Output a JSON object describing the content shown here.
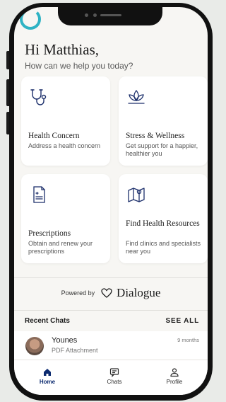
{
  "header": {
    "greeting": "Hi Matthias,",
    "subtitle": "How can we help you today?"
  },
  "cards": [
    {
      "title": "Health Concern",
      "description": "Address a health concern",
      "icon": "stethoscope-icon"
    },
    {
      "title": "Stress & Wellness",
      "description": "Get support for a happier, healthier you",
      "icon": "lotus-icon"
    },
    {
      "title": "Prescriptions",
      "description": "Obtain and renew your prescriptions",
      "icon": "prescription-icon"
    },
    {
      "title": "Find Health Resources",
      "description": "Find clinics and specialists near you",
      "icon": "map-icon"
    }
  ],
  "powered": {
    "label": "Powered by",
    "brand": "Dialogue"
  },
  "recent": {
    "heading": "Recent Chats",
    "see_all": "SEE ALL",
    "items": [
      {
        "name": "Younes",
        "preview": "PDF Attachment",
        "time": "9 months"
      }
    ]
  },
  "tabs": [
    {
      "label": "Home",
      "icon": "home-icon",
      "active": true
    },
    {
      "label": "Chats",
      "icon": "chat-icon",
      "active": false
    },
    {
      "label": "Profile",
      "icon": "profile-icon",
      "active": false
    }
  ],
  "colors": {
    "accent": "#2fb3c4",
    "active_tab": "#0b2a6f",
    "background": "#f7f6f3"
  }
}
